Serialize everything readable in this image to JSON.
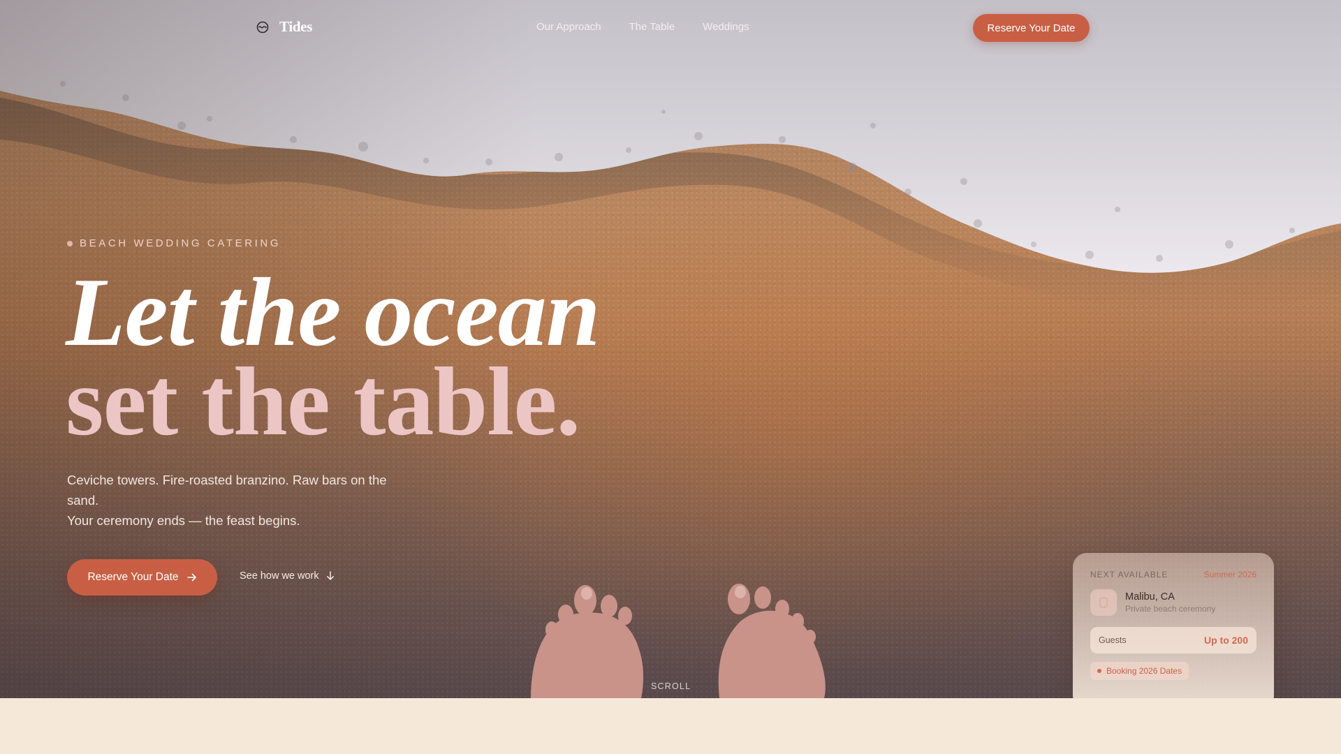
{
  "brand": {
    "name": "Tides",
    "icon": "wave-logo-icon"
  },
  "nav": {
    "links": [
      {
        "label": "Our Approach"
      },
      {
        "label": "The Table"
      },
      {
        "label": "Weddings"
      }
    ],
    "cta_label": "Reserve Your Date"
  },
  "hero": {
    "eyebrow": "BEACH WEDDING CATERING",
    "headline_line1": "Let the ocean",
    "headline_line2": "set the table.",
    "subcopy_line1": "Ceviche towers. Fire-roasted branzino. Raw bars on the sand.",
    "subcopy_line2": "Your ceremony ends — the feast begins.",
    "primary_cta": "Reserve Your Date",
    "secondary_cta": "See how we work",
    "scroll_hint": "SCROLL"
  },
  "availability_card": {
    "label": "NEXT AVAILABLE",
    "season": "Summer 2026",
    "location_city": "Malibu, CA",
    "location_type": "Private beach ceremony",
    "guests_label": "Guests",
    "guests_value": "Up to 200",
    "badge": "Booking 2026 Dates"
  },
  "colors": {
    "accent": "#c85f44",
    "headline_pink": "#ebc6c5",
    "cream": "#f6e8d8"
  }
}
